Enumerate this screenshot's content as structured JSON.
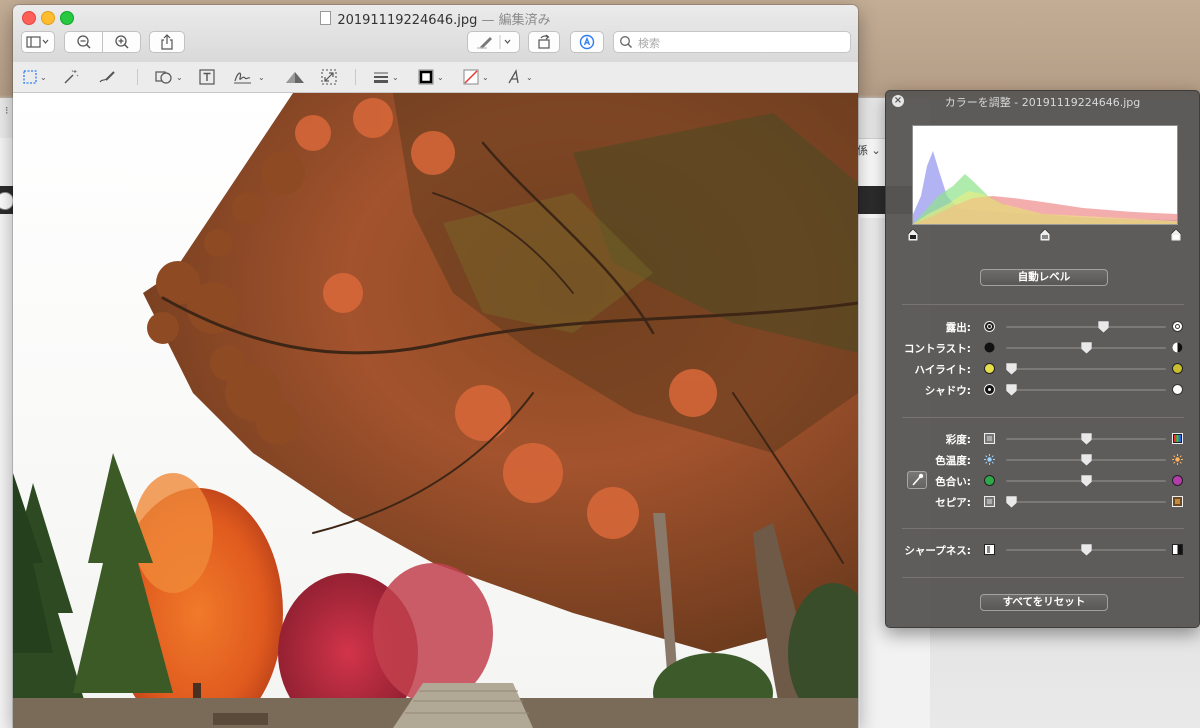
{
  "window": {
    "title": "20191119224646.jpg",
    "title_suffix": "— 編集済み"
  },
  "toolbar": {
    "search_placeholder": "検索",
    "icons": [
      "sidebar-icon",
      "zoom-out-icon",
      "zoom-in-icon",
      "share-icon",
      "highlight-pen-icon",
      "rotate-icon",
      "markup-icon",
      "search-icon"
    ]
  },
  "markup_toolbar": {
    "tools": [
      "rect-select-icon",
      "instant-alpha-icon",
      "sketch-icon",
      "shapes-icon",
      "text-icon",
      "sign-icon",
      "adjust-color-icon",
      "adjust-size-icon",
      "line-style-icon",
      "border-color-icon",
      "fill-color-icon",
      "text-style-icon"
    ]
  },
  "background_window": {
    "fragment_text": "係 ⌄",
    "dots": "⁝"
  },
  "adjust_color_panel": {
    "title": "カラーを調整 - 20191119224646.jpg",
    "auto_levels_label": "自動レベル",
    "reset_all_label": "すべてをリセット",
    "tone_sliders": [
      {
        "label": "露出:",
        "value": 0.62
      },
      {
        "label": "コントラスト:",
        "value": 0.5
      },
      {
        "label": "ハイライト:",
        "value": 0.0
      },
      {
        "label": "シャドウ:",
        "value": 0.0
      }
    ],
    "color_sliders": [
      {
        "label": "彩度:",
        "value": 0.5
      },
      {
        "label": "色温度:",
        "value": 0.5
      },
      {
        "label": "色合い:",
        "value": 0.5
      },
      {
        "label": "セピア:",
        "value": 0.0
      }
    ],
    "sharpness": {
      "label": "シャープネス:",
      "value": 0.5
    },
    "histogram_levels": {
      "black": 0.0,
      "mid": 0.5,
      "white": 1.0
    }
  },
  "colors": {
    "panel_bg": "#585654",
    "close_red": "#fe5f57",
    "minimize_yellow": "#febc2e",
    "zoom_green": "#28c840"
  }
}
